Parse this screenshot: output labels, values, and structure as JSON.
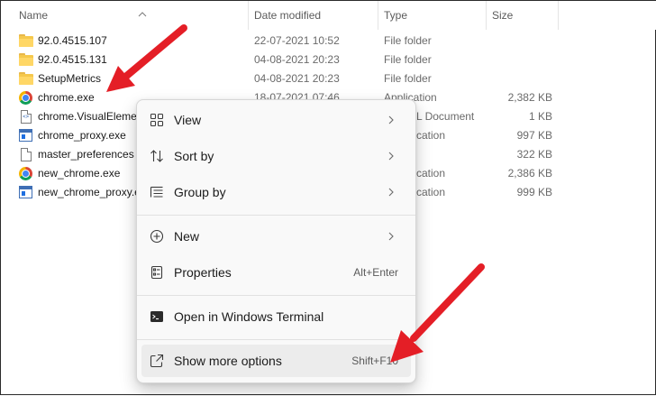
{
  "columns": {
    "name": "Name",
    "date": "Date modified",
    "type": "Type",
    "size": "Size"
  },
  "files": [
    {
      "icon": "folder-icon",
      "name": "92.0.4515.107",
      "date": "22-07-2021 10:52",
      "type": "File folder",
      "size": ""
    },
    {
      "icon": "folder-icon",
      "name": "92.0.4515.131",
      "date": "04-08-2021 20:23",
      "type": "File folder",
      "size": ""
    },
    {
      "icon": "folder-icon",
      "name": "SetupMetrics",
      "date": "04-08-2021 20:23",
      "type": "File folder",
      "size": ""
    },
    {
      "icon": "chrome-icon",
      "name": "chrome.exe",
      "date": "18-07-2021 07:46",
      "type": "Application",
      "size": "2,382 KB"
    },
    {
      "icon": "xml-document-icon",
      "name": "chrome.VisualEleme",
      "date": "",
      "type": "L Document",
      "size": "1 KB"
    },
    {
      "icon": "application-icon",
      "name": "chrome_proxy.exe",
      "date": "",
      "type": "cation",
      "size": "997 KB"
    },
    {
      "icon": "document-icon",
      "name": "master_preferences",
      "date": "",
      "type": "",
      "size": "322 KB"
    },
    {
      "icon": "chrome-icon",
      "name": "new_chrome.exe",
      "date": "",
      "type": "cation",
      "size": "2,386 KB"
    },
    {
      "icon": "application-icon",
      "name": "new_chrome_proxy.e",
      "date": "",
      "type": "cation",
      "size": "999 KB"
    }
  ],
  "context_menu": {
    "items": [
      {
        "icon": "view-icon",
        "label": "View",
        "shortcut": "",
        "submenu": true
      },
      {
        "icon": "sort-icon",
        "label": "Sort by",
        "shortcut": "",
        "submenu": true
      },
      {
        "icon": "group-icon",
        "label": "Group by",
        "shortcut": "",
        "submenu": true
      },
      {
        "icon": "new-icon",
        "label": "New",
        "shortcut": "",
        "submenu": true
      },
      {
        "icon": "properties-icon",
        "label": "Properties",
        "shortcut": "Alt+Enter",
        "submenu": false
      },
      {
        "icon": "terminal-icon",
        "label": "Open in Windows Terminal",
        "shortcut": "",
        "submenu": false
      },
      {
        "icon": "open-external-icon",
        "label": "Show more options",
        "shortcut": "Shift+F10",
        "submenu": false
      }
    ]
  },
  "colors": {
    "annotation_arrow": "#e41e26",
    "menu_background": "#f9f9f9",
    "menu_hover": "#ececec",
    "accent_blue": "#1f6fe0"
  }
}
